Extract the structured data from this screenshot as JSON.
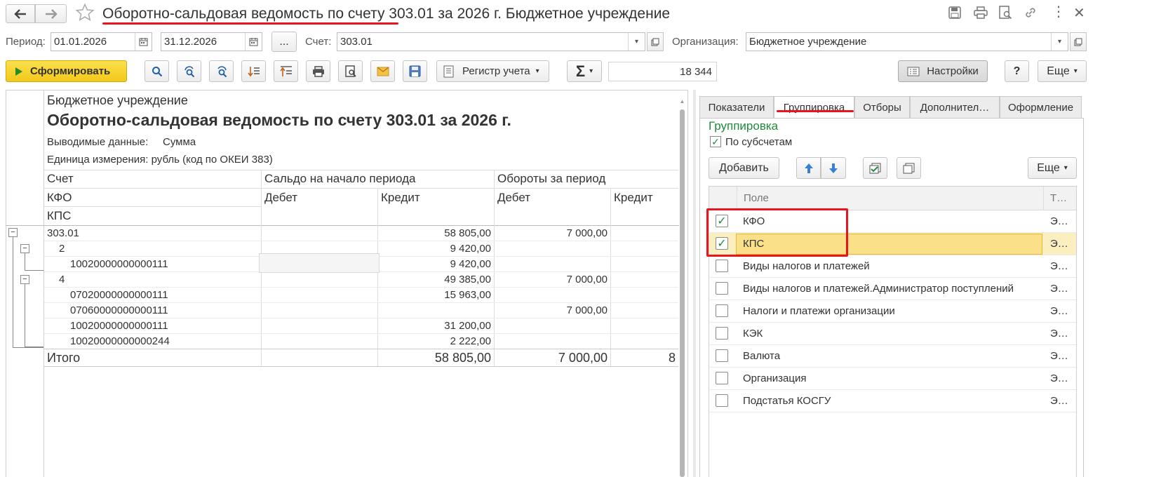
{
  "window": {
    "title": "Оборотно-сальдовая ведомость по счету 303.01 за 2026 г. Бюджетное учреждение"
  },
  "filters": {
    "period_label": "Период:",
    "period_from": "01.01.2026",
    "period_to": "31.12.2026",
    "ellipsis": "...",
    "account_label": "Счет:",
    "account_value": "303.01",
    "org_label": "Организация:",
    "org_value": "Бюджетное учреждение"
  },
  "toolbar": {
    "generate": "Сформировать",
    "register": "Регистр учета",
    "sigma": "Σ",
    "sum_value": "18 344",
    "settings": "Настройки",
    "help": "?",
    "more": "Еще"
  },
  "report": {
    "org": "Бюджетное учреждение",
    "title": "Оборотно-сальдовая ведомость по счету 303.01 за 2026 г.",
    "output_label": "Выводимые данные:",
    "output_value": "Сумма",
    "unit": "Единица измерения: рубль (код по ОКЕИ 383)",
    "headers": {
      "account": "Счет",
      "kfo": "КФО",
      "kps": "КПС",
      "opening": "Сальдо на начало периода",
      "turnover": "Обороты за период",
      "debit1": "Дебет",
      "credit1": "Кредит",
      "debit2": "Дебет",
      "credit2": "Кредит"
    },
    "rows": [
      {
        "name": "303.01",
        "credit": "58 805,00",
        "debit2": "7 000,00"
      },
      {
        "name": "2",
        "credit": "9 420,00",
        "debit2": ""
      },
      {
        "name": "10020000000000111",
        "credit": "9 420,00",
        "debit2": ""
      },
      {
        "name": "4",
        "credit": "49 385,00",
        "debit2": "7 000,00"
      },
      {
        "name": "07020000000000111",
        "credit": "15 963,00",
        "debit2": ""
      },
      {
        "name": "07060000000000111",
        "credit": "",
        "debit2": "7 000,00"
      },
      {
        "name": "10020000000000111",
        "credit": "31 200,00",
        "debit2": ""
      },
      {
        "name": "10020000000000244",
        "credit": "2 222,00",
        "debit2": ""
      }
    ],
    "total": {
      "label": "Итого",
      "credit": "58 805,00",
      "debit2": "7 000,00",
      "credit2": "8"
    }
  },
  "settings_panel": {
    "tabs": [
      "Показатели",
      "Группировка",
      "Отборы",
      "Дополнител…",
      "Оформление"
    ],
    "section_title": "Группировка",
    "by_subaccounts": "По субсчетам",
    "add": "Добавить",
    "more": "Еще",
    "col_field": "Поле",
    "col_type": "Т…",
    "fields": [
      {
        "name": "КФО",
        "checked": true,
        "type": "Э…"
      },
      {
        "name": "КПС",
        "checked": true,
        "type": "Э…"
      },
      {
        "name": "Виды налогов и платежей",
        "checked": false,
        "type": "Э…"
      },
      {
        "name": "Виды налогов и платежей.Администратор поступлений",
        "checked": false,
        "type": "Э…"
      },
      {
        "name": "Налоги и платежи организации",
        "checked": false,
        "type": "Э…"
      },
      {
        "name": "КЭК",
        "checked": false,
        "type": "Э…"
      },
      {
        "name": "Валюта",
        "checked": false,
        "type": "Э…"
      },
      {
        "name": "Организация",
        "checked": false,
        "type": "Э…"
      },
      {
        "name": "Подстатья КОСГУ",
        "checked": false,
        "type": "Э…"
      }
    ]
  },
  "colors": {
    "accent_green": "#1e8c3a",
    "highlight_red": "#e8141e",
    "selected_row": "#fbe9a9",
    "generate_yellow": "#f5d32a"
  }
}
